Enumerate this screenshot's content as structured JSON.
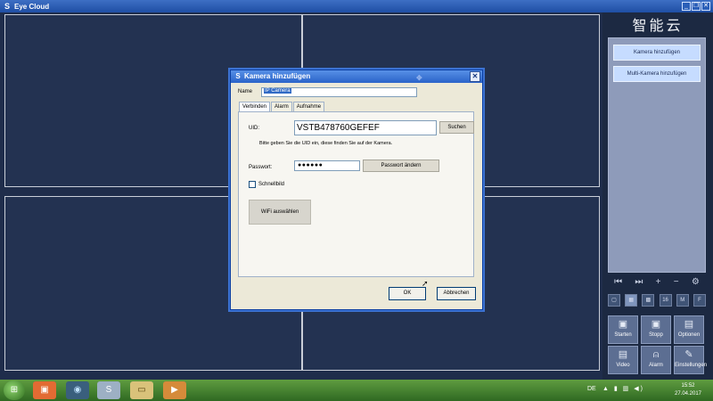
{
  "window": {
    "title": "Eye Cloud",
    "controls": [
      "_",
      "❐",
      "✕"
    ]
  },
  "sidebar": {
    "brand": "智能云",
    "list_buttons": [
      {
        "label": "Kamera hinzufügen"
      },
      {
        "label": "Multi-Kamera hinzufügen"
      }
    ],
    "list_tools": [
      "⏮",
      "⏭",
      "+",
      "−",
      "⚙"
    ],
    "layout_buttons": [
      {
        "label": "▢"
      },
      {
        "label": "▦"
      },
      {
        "label": "▩"
      },
      {
        "label": "16"
      },
      {
        "label": "M"
      },
      {
        "label": "F"
      }
    ],
    "action_buttons": [
      {
        "label": "Starten",
        "icon": "▣"
      },
      {
        "label": "Stopp",
        "icon": "▣"
      },
      {
        "label": "Optionen",
        "icon": "▤"
      },
      {
        "label": "Video",
        "icon": "▤"
      },
      {
        "label": "Alarm",
        "icon": "⍝"
      },
      {
        "label": "Einstellungen",
        "icon": "✎"
      }
    ]
  },
  "dialog": {
    "title": "Kamera hinzufügen",
    "name_label": "Name",
    "name_value": "IP Camera",
    "tabs": [
      "Verbinden",
      "Alarm",
      "Aufnahme"
    ],
    "uid_label": "UID:",
    "uid_value": "VSTB478760GEFEF",
    "search_label": "Suchen",
    "uid_hint": "Bitte geben Sie die UID ein, diese finden Sie auf der Kamera.",
    "password_label": "Passwort:",
    "password_value": "●●●●●●",
    "change_password_label": "Passwort ändern",
    "quick_image_label": "Schnellbild",
    "wifi_label": "WiFi auswählen",
    "ok_label": "OK",
    "cancel_label": "Abbrechen"
  },
  "taskbar": {
    "language": "DE",
    "time": "15:52",
    "date": "27.04.2017"
  }
}
